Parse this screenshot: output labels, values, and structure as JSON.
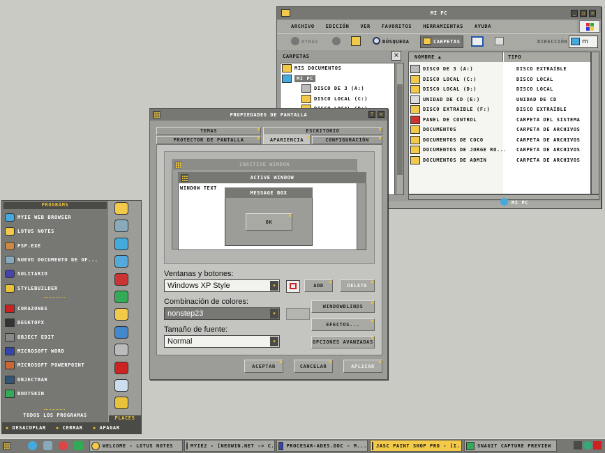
{
  "explorer": {
    "title": "mi pc",
    "menu": [
      "archivo",
      "edición",
      "ver",
      "favoritos",
      "herramientas",
      "ayuda"
    ],
    "toolbar": {
      "back": "atrás",
      "search": "búsqueda",
      "folders": "carpetas",
      "address_label": "dirección",
      "address_value": "m"
    },
    "folders_header": "carpetas",
    "tree": [
      "mis documentos",
      "mi pc",
      "disco de 3 (a:)",
      "disco local (c:)",
      "disco local (d:)"
    ],
    "cols": {
      "name": "nombre",
      "type": "tipo"
    },
    "rows": [
      {
        "name": "disco de 3 (a:)",
        "type": "disco extraíble",
        "icon": "floppy-icon"
      },
      {
        "name": "disco local (c:)",
        "type": "disco local",
        "icon": "drive-icon"
      },
      {
        "name": "disco local (d:)",
        "type": "disco local",
        "icon": "drive-icon"
      },
      {
        "name": "unidad de cd (e:)",
        "type": "unidad de cd",
        "icon": "cd-icon"
      },
      {
        "name": "disco extraíble (f:)",
        "type": "disco extraíble",
        "icon": "drive-icon"
      },
      {
        "name": "panel de control",
        "type": "carpeta del sistema",
        "icon": "tools-icon"
      },
      {
        "name": "documentos",
        "type": "carpeta de archivos",
        "icon": "folder-icon"
      },
      {
        "name": "documentos de coco",
        "type": "carpeta de archivos",
        "icon": "folder-icon"
      },
      {
        "name": "documentos de jorge ro...",
        "type": "carpeta de archivos",
        "icon": "folder-icon"
      },
      {
        "name": "documentos de admin",
        "type": "carpeta de archivos",
        "icon": "folder-icon"
      }
    ],
    "status": "mi pc"
  },
  "dialog": {
    "title": "propiedades de pantalla",
    "tabs_row1": [
      "temas",
      "escritorio"
    ],
    "tabs_row2": [
      "protector de pantalla",
      "apariencia",
      "configuración"
    ],
    "preview": {
      "inactive": "inactive window",
      "active": "active window",
      "text": "window text",
      "msgbox": "message box",
      "ok": "ok"
    },
    "l1": "Ventanas y botones:",
    "v1": "Windows XP Style",
    "l2": "Combinación de colores:",
    "v2": "nonstep23",
    "l3": "Tamaño de fuente:",
    "v3": "Normal",
    "add": "add",
    "delete": "delete",
    "wb": "windowblinds",
    "effects": "efectos...",
    "advanced": "opciones avanzadas",
    "ok": "aceptar",
    "cancel": "cancelar",
    "apply": "aplicar"
  },
  "start": {
    "programs": "programs",
    "pinned": [
      "myie web browser",
      "lotus notes",
      "psp.exe",
      "nuevo documento de of...",
      "solitario",
      "stylebuilder"
    ],
    "recent": [
      "corazones",
      "desktopx",
      "object edit",
      "microsoft word",
      "microsoft powerpoint",
      "objectbar",
      "bootskin"
    ],
    "all": "todos los programas",
    "places": "places",
    "undock": "desacoplar",
    "close": "cerrar",
    "shutdown": "apagar"
  },
  "taskbar": {
    "tasks": [
      "welcome - lotus notes",
      "myie2 - [neowin.net -> c...",
      "procesar-ades.doc - m...",
      "jasc paint shop pro - [i...",
      "snagit capture preview"
    ]
  },
  "colors": {
    "accent": "#e8c23a",
    "bar": "#777874",
    "desktop": "#c9cac4"
  }
}
